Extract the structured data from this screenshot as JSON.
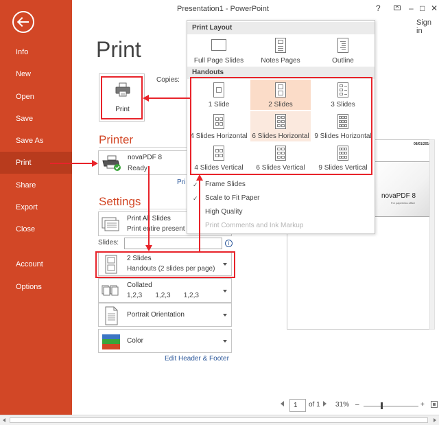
{
  "window": {
    "title": "Presentation1 - PowerPoint",
    "help": "?",
    "sign_in": "Sign in",
    "controls": [
      "–",
      "□",
      "✕"
    ]
  },
  "nav": {
    "back_icon": "back-arrow-icon",
    "items": [
      "Info",
      "New",
      "Open",
      "Save",
      "Save As",
      "Print",
      "Share",
      "Export",
      "Close",
      "Account",
      "Options"
    ],
    "active": "Print"
  },
  "print": {
    "heading": "Print",
    "button_label": "Print",
    "copies_label": "Copies:"
  },
  "printer": {
    "heading": "Printer",
    "name": "novaPDF 8",
    "status": "Ready",
    "properties_link": "Pri"
  },
  "settings": {
    "heading": "Settings",
    "print_all": {
      "title": "Print All Slides",
      "subtitle": "Print entire present"
    },
    "slides_label": "Slides:",
    "slides_value": "",
    "info_icon": "i",
    "layout": {
      "title": "2 Slides",
      "subtitle": "Handouts (2 slides per page)"
    },
    "collated": {
      "title": "Collated",
      "subtitle": "1,2,3    1,2,3    1,2,3"
    },
    "orientation": {
      "title": "Portrait Orientation"
    },
    "color": {
      "title": "Color"
    },
    "edit_link": "Edit Header & Footer"
  },
  "dropdown": {
    "print_layout_header": "Print Layout",
    "print_layout": [
      "Full Page Slides",
      "Notes Pages",
      "Outline"
    ],
    "handouts_header": "Handouts",
    "handouts": [
      "1 Slide",
      "2 Slides",
      "3 Slides",
      "4 Slides Horizontal",
      "6 Slides Horizontal",
      "9 Slides Horizontal",
      "4 Slides Vertical",
      "6 Slides Vertical",
      "9 Slides Vertical"
    ],
    "selected": "2 Slides",
    "hovered": "6 Slides Horizontal",
    "options": [
      {
        "label": "Frame Slides",
        "checked": true,
        "enabled": true
      },
      {
        "label": "Scale to Fit Paper",
        "checked": true,
        "enabled": true
      },
      {
        "label": "High Quality",
        "checked": false,
        "enabled": true
      },
      {
        "label": "Print Comments and Ink Markup",
        "checked": false,
        "enabled": false
      }
    ],
    "check_glyph": "✓"
  },
  "preview": {
    "date": "08/01/2014",
    "slide_title": "novaPDF 8",
    "slide_subtitle": "For paperless office"
  },
  "pager": {
    "page_value": "1",
    "of_text": "of 1",
    "zoom": "31%",
    "zoom_minus": "–",
    "zoom_plus": "+"
  },
  "colors": {
    "accent": "#d24726",
    "accent_active": "#b83b1d",
    "annotation_red": "#e8232a",
    "link_blue": "#2b579a",
    "selected_fill": "#fbdcc8"
  }
}
